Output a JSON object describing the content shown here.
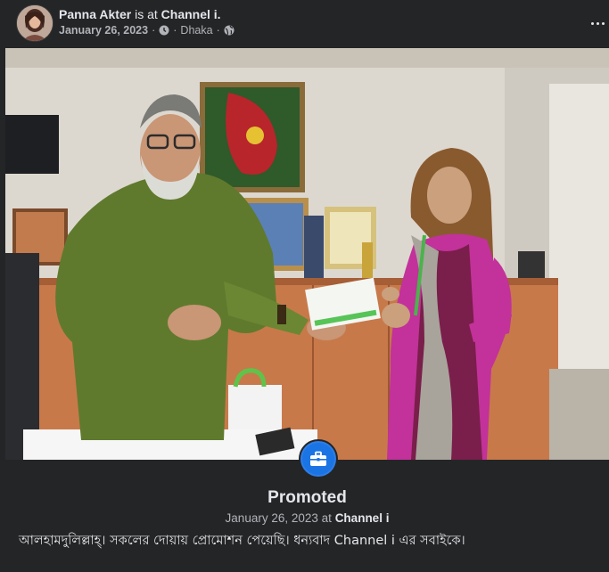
{
  "post": {
    "author": "Panna Akter",
    "connector": "is at",
    "place": "Channel i.",
    "date": "January 26, 2023",
    "separator": "·",
    "location": "Dhaka"
  },
  "event": {
    "title": "Promoted",
    "date": "January 26, 2023",
    "connector": "at",
    "place": "Channel i"
  },
  "caption": "আলহামদুলিল্লাহ্। সকলের দোয়ায় প্রোমোশন পেয়েছি। ধন্যবাদ Channel i এর সবাইকে।",
  "colors": {
    "background": "#242526",
    "text_primary": "#e4e6eb",
    "text_secondary": "#b0b3b8",
    "badge": "#1b74e4"
  },
  "icons": {
    "clock": "clock-icon",
    "globe": "globe-icon",
    "more": "more-icon",
    "badge": "briefcase-icon"
  }
}
